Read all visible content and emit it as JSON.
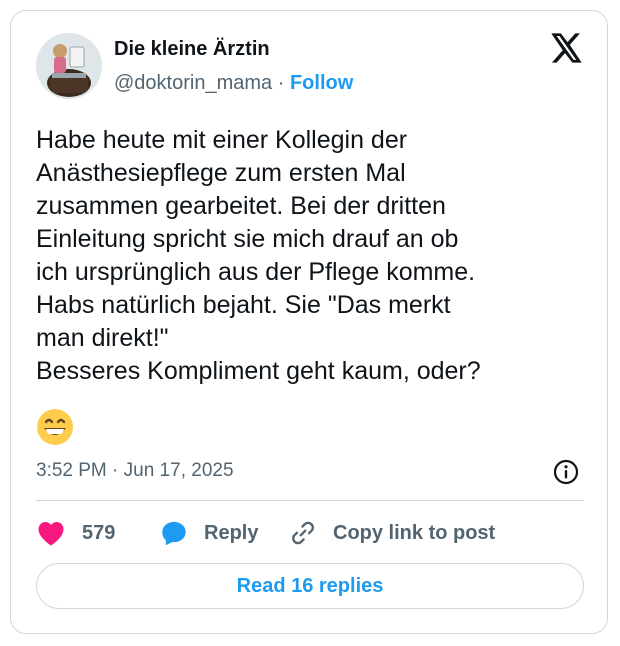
{
  "author": {
    "name": "Die kleine Ärztin",
    "handle": "@doktorin_mama",
    "separator": "·",
    "follow_label": "Follow"
  },
  "brand_icon": "x-logo-icon",
  "post": {
    "text": "Habe heute mit einer Kollegin der\nAnästhesiepflege zum ersten Mal\nzusammen gearbeitet. Bei der dritten\nEinleitung spricht sie mich drauf an ob\nich ursprünglich aus der Pflege komme.\nHabs natürlich bejaht. Sie \"Das merkt\nman direkt!\"\nBesseres Kompliment geht kaum, oder?",
    "emoji": "grinning-face-emoji",
    "timestamp": "3:52 PM · Jun 17, 2025"
  },
  "actions": {
    "like_count": "579",
    "reply_label": "Reply",
    "copy_label": "Copy link to post"
  },
  "read_replies_label": "Read 16 replies",
  "colors": {
    "accent": "#1d9bf0",
    "like": "#f91880",
    "secondary_text": "#536471",
    "border": "#cfd9de"
  }
}
